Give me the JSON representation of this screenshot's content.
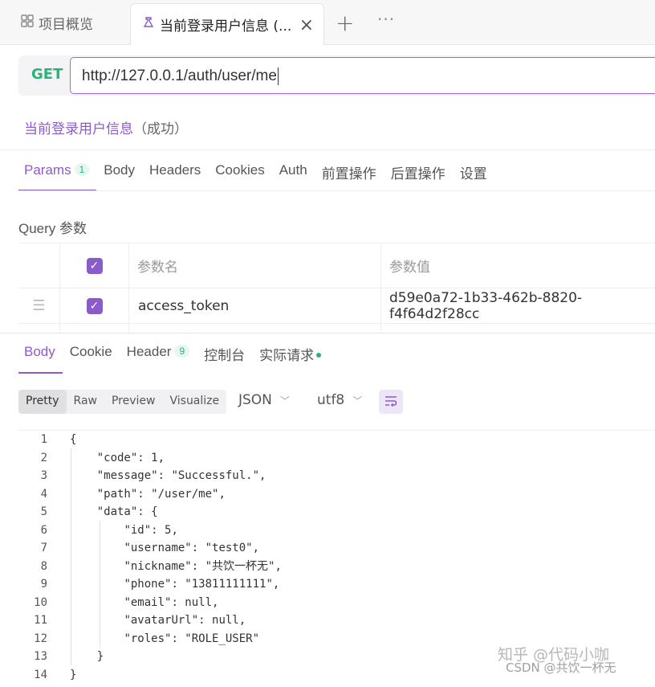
{
  "tabs": {
    "overview": "项目概览",
    "active": "当前登录用户信息 (...",
    "close": "×",
    "new": "+",
    "more": "···"
  },
  "request": {
    "method": "GET",
    "url": "http://127.0.0.1/auth/user/me",
    "title": "当前登录用户信息",
    "status": "（成功）"
  },
  "request_tabs": [
    {
      "label": "Params",
      "badge": "1"
    },
    {
      "label": "Body"
    },
    {
      "label": "Headers"
    },
    {
      "label": "Cookies"
    },
    {
      "label": "Auth"
    },
    {
      "label": "前置操作"
    },
    {
      "label": "后置操作"
    },
    {
      "label": "设置"
    }
  ],
  "params": {
    "section_label": "Query 参数",
    "col_name": "参数名",
    "col_value": "参数值",
    "rows": [
      {
        "name": "access_token",
        "value": "d59e0a72-1b33-462b-8820-f4f64d2f28cc"
      }
    ]
  },
  "response_tabs": [
    {
      "label": "Body"
    },
    {
      "label": "Cookie"
    },
    {
      "label": "Header",
      "badge": "9"
    },
    {
      "label": "控制台"
    },
    {
      "label": "实际请求"
    }
  ],
  "view_modes": [
    "Pretty",
    "Raw",
    "Preview",
    "Visualize"
  ],
  "format": "JSON",
  "encoding": "utf8",
  "code_lines": [
    "{",
    "    \"code\": 1,",
    "    \"message\": \"Successful.\",",
    "    \"path\": \"/user/me\",",
    "    \"data\": {",
    "        \"id\": 5,",
    "        \"username\": \"test0\",",
    "        \"nickname\": \"共饮一杯无\",",
    "        \"phone\": \"13811111111\",",
    "        \"email\": null,",
    "        \"avatarUrl\": null,",
    "        \"roles\": \"ROLE_USER\"",
    "    }",
    "}"
  ],
  "watermark": {
    "line1": "知乎 @代码小咖",
    "line2": "CSDN @共饮一杯无"
  },
  "colors": {
    "accent": "#8a5cc9",
    "get_method": "#2bb37c",
    "string_value": "#1a56b0"
  }
}
